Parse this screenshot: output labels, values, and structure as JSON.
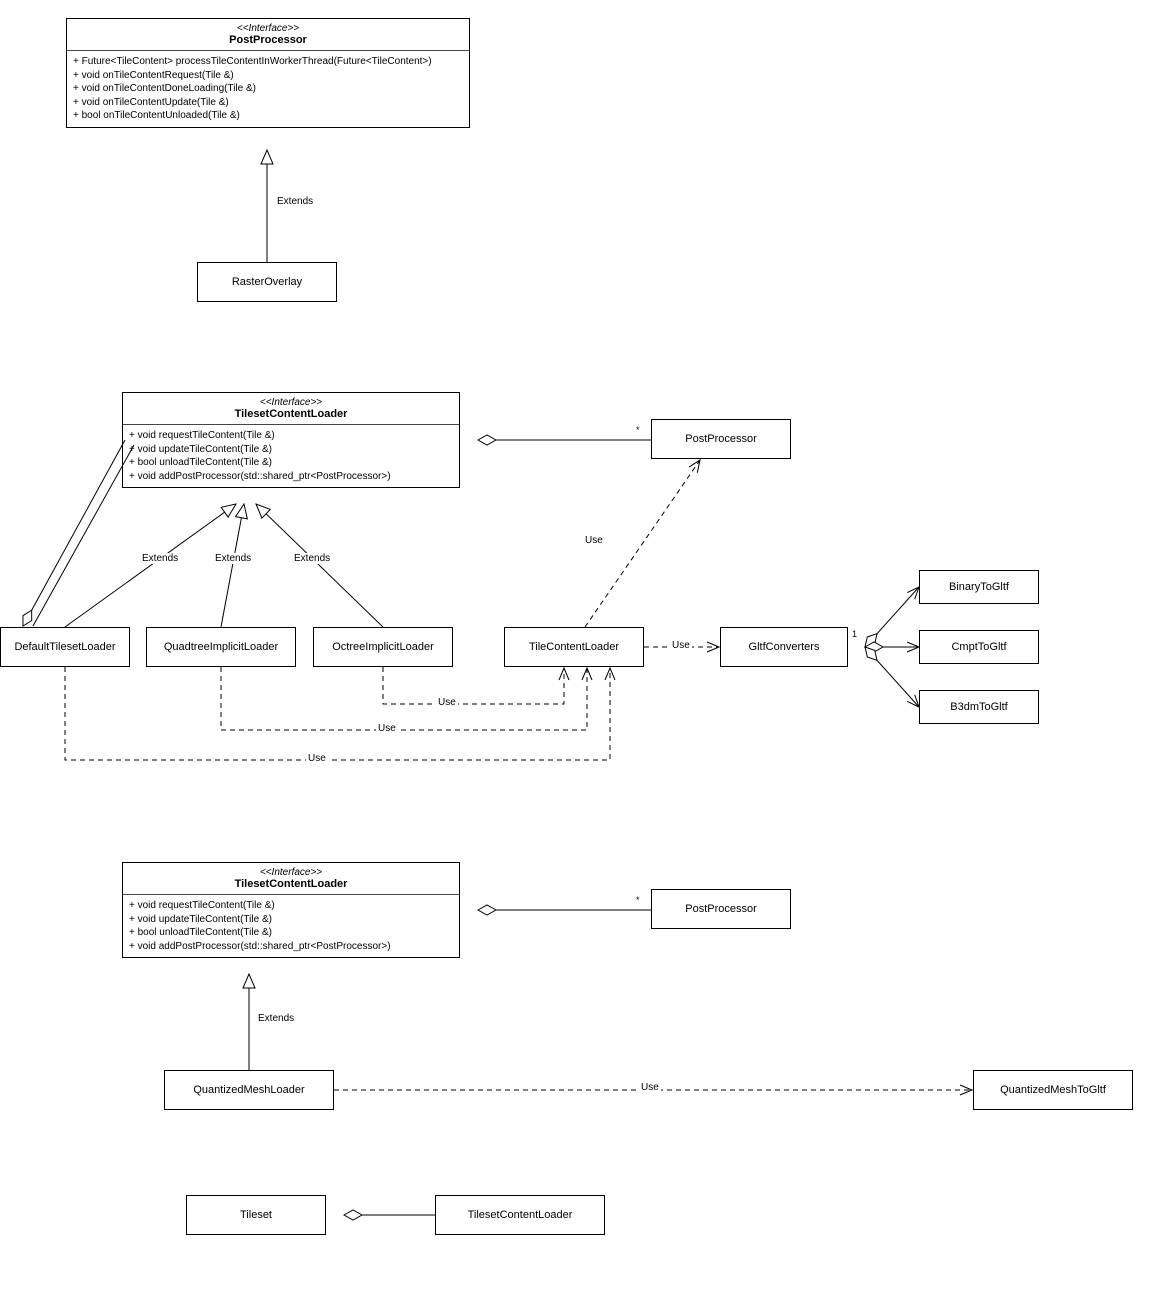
{
  "diagram": {
    "postProcessor": {
      "stereotype": "<<Interface>>",
      "name": "PostProcessor",
      "methods": [
        "+ Future<TileContent> processTileContentInWorkerThread(Future<TileContent>)",
        "+ void onTileContentRequest(Tile &)",
        "+ void onTileContentDoneLoading(Tile &)",
        "+ void onTileContentUpdate(Tile &)",
        "+ bool onTileContentUnloaded(Tile &)"
      ]
    },
    "rasterOverlay": {
      "name": "RasterOverlay"
    },
    "tilesetContentLoader1": {
      "stereotype": "<<Interface>>",
      "name": "TilesetContentLoader",
      "methods": [
        "+ void requestTileContent(Tile &)",
        "+ void updateTileContent(Tile &)",
        "+ bool unloadTileContent(Tile &)",
        "+ void addPostProcessor(std::shared_ptr<PostProcessor>)"
      ]
    },
    "postProcessorRef1": {
      "name": "PostProcessor"
    },
    "defaultTilesetLoader": {
      "name": "DefaultTilesetLoader"
    },
    "quadtreeImplicitLoader": {
      "name": "QuadtreeImplicitLoader"
    },
    "octreeImplicitLoader": {
      "name": "OctreeImplicitLoader"
    },
    "tileContentLoader": {
      "name": "TileContentLoader"
    },
    "gltfConverters": {
      "name": "GltfConverters"
    },
    "binaryToGltf": {
      "name": "BinaryToGltf"
    },
    "cmptToGltf": {
      "name": "CmptToGltf"
    },
    "b3dmToGltf": {
      "name": "B3dmToGltf"
    },
    "tilesetContentLoader2": {
      "stereotype": "<<Interface>>",
      "name": "TilesetContentLoader",
      "methods": [
        "+ void requestTileContent(Tile &)",
        "+ void updateTileContent(Tile &)",
        "+ bool unloadTileContent(Tile &)",
        "+ void addPostProcessor(std::shared_ptr<PostProcessor>)"
      ]
    },
    "postProcessorRef2": {
      "name": "PostProcessor"
    },
    "quantizedMeshLoader": {
      "name": "QuantizedMeshLoader"
    },
    "quantizedMeshToGltf": {
      "name": "QuantizedMeshToGltf"
    },
    "tileset": {
      "name": "Tileset"
    },
    "tilesetContentLoaderRef": {
      "name": "TilesetContentLoader"
    },
    "labels": {
      "extends": "Extends",
      "use": "Use"
    },
    "multiplicity": {
      "star": "*",
      "one": "1"
    }
  }
}
